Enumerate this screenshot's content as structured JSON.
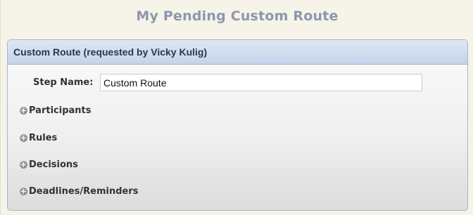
{
  "page": {
    "title": "My Pending Custom Route"
  },
  "panel": {
    "header": "Custom Route (requested by Vicky Kulig)",
    "step_name": {
      "label": "Step Name:",
      "value": "Custom Route"
    },
    "sections": [
      {
        "label": "Participants",
        "icon": "expand-plus-icon"
      },
      {
        "label": "Rules",
        "icon": "expand-plus-icon"
      },
      {
        "label": "Decisions",
        "icon": "expand-plus-icon"
      },
      {
        "label": "Deadlines/Reminders",
        "icon": "expand-plus-icon"
      }
    ]
  },
  "colors": {
    "title": "#8b97ad",
    "header_bg": "#c6d3e8",
    "page_bg": "#f6f3e8"
  }
}
